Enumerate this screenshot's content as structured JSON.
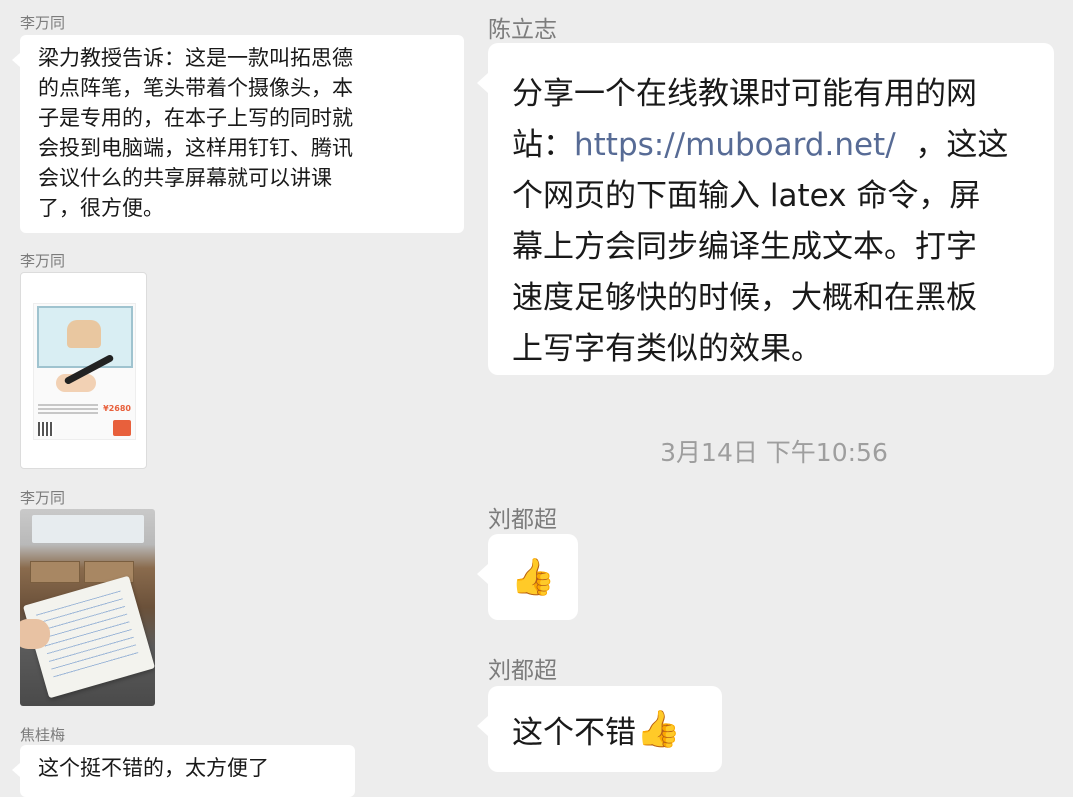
{
  "left": {
    "messages": [
      {
        "sender": "李万同",
        "lines": [
          "梁力教授告诉：这是一款叫拓思德",
          "的点阵笔，笔头带着个摄像头，本",
          "子是专用的，在本子上写的同时就",
          "会投到电脑端，这样用钉钉、腾讯",
          "会议什么的共享屏幕就可以讲课",
          "了，很方便。"
        ]
      },
      {
        "sender": "李万同",
        "image": {
          "price": "¥2680"
        }
      },
      {
        "sender": "李万同",
        "image": "photo"
      },
      {
        "sender": "焦桂梅",
        "text": "这个挺不错的，太方便了"
      }
    ]
  },
  "right": {
    "messages": [
      {
        "sender": "陈立志",
        "lines": [
          "分享一个在线教课时可能有用的网",
          {
            "prefix": "站：",
            "link": "https://muboard.net/",
            "suffix": "  ，这这"
          },
          "个网页的下面输入 latex 命令，屏",
          "幕上方会同步编译生成文本。打字",
          "速度足够快的时候，大概和在黑板",
          "上写字有类似的效果。"
        ]
      },
      {
        "timestamp": "3月14日 下午10:56"
      },
      {
        "sender": "刘都超",
        "emoji": "👍"
      },
      {
        "sender": "刘都超",
        "text": "这个不错",
        "emoji": "👍"
      }
    ]
  },
  "colors": {
    "background": "#ededed",
    "bubble": "#ffffff",
    "sender": "#7c7c7c",
    "link": "#576b95",
    "timestamp": "#9e9e9e"
  }
}
